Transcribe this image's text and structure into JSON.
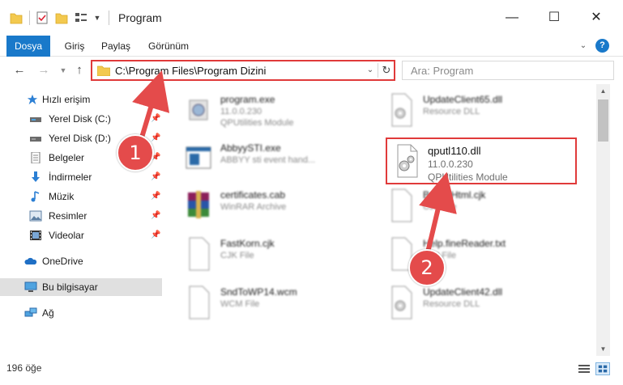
{
  "window": {
    "title": "Program",
    "minimize": "—",
    "maximize": "☐",
    "close": "✕"
  },
  "ribbon": {
    "tabs": [
      "Dosya",
      "Giriş",
      "Paylaş",
      "Görünüm"
    ],
    "active_tab": "Dosya",
    "help": "?"
  },
  "nav": {
    "back": "←",
    "forward": "→",
    "recent": "⌄",
    "up": "↑",
    "address": "C:\\Program Files\\Program Dizini",
    "refresh": "↻",
    "search_placeholder": "Ara: Program"
  },
  "sidebar": {
    "items": [
      {
        "label": "Hızlı erişim",
        "icon": "star-icon"
      },
      {
        "label": "Yerel Disk (C:)",
        "icon": "drive-icon",
        "pinned": true
      },
      {
        "label": "Yerel Disk (D:)",
        "icon": "drive-icon",
        "pinned": true
      },
      {
        "label": "Belgeler",
        "icon": "documents-icon",
        "pinned": true
      },
      {
        "label": "İndirmeler",
        "icon": "download-icon",
        "pinned": true
      },
      {
        "label": "Müzik",
        "icon": "music-icon",
        "pinned": true
      },
      {
        "label": "Resimler",
        "icon": "pictures-icon",
        "pinned": true
      },
      {
        "label": "Videolar",
        "icon": "video-icon",
        "pinned": true
      },
      {
        "label": "OneDrive",
        "icon": "cloud-icon"
      },
      {
        "label": "Bu bilgisayar",
        "icon": "computer-icon",
        "selected": true
      },
      {
        "label": "Ağ",
        "icon": "network-icon"
      }
    ]
  },
  "files": [
    {
      "name": "program.exe",
      "line1": "11.0.0.230",
      "line2": "QPUtilities Module",
      "icon": "exe-icon"
    },
    {
      "name": "UpdateClient65.dll",
      "line1": "Resource DLL",
      "line2": "",
      "icon": "dll-gear-icon"
    },
    {
      "name": "AbbyySTI.exe",
      "line1": "ABBYY sti event hand...",
      "line2": "",
      "icon": "exe-window-icon"
    },
    {
      "name": "certificates.cab",
      "line1": "WinRAR Archive",
      "line2": "",
      "icon": "winrar-icon"
    },
    {
      "name": "ButtonHtml.cjk",
      "line1": "CJK File",
      "line2": "",
      "icon": "blank-file-icon"
    },
    {
      "name": "FastKorn.cjk",
      "line1": "CJK File",
      "line2": "",
      "icon": "blank-file-icon"
    },
    {
      "name": "Help.fineReader.txt",
      "line1": "Text File",
      "line2": "",
      "icon": "blank-file-icon"
    },
    {
      "name": "SndToWP14.wcm",
      "line1": "WCM File",
      "line2": "",
      "icon": "blank-file-icon"
    },
    {
      "name": "UpdateClient42.dll",
      "line1": "Resource DLL",
      "line2": "",
      "icon": "dll-gear-icon"
    }
  ],
  "highlighted_file": {
    "name": "qputl110.dll",
    "line1": "11.0.0.230",
    "line2": "QPUtilities Module"
  },
  "annotations": {
    "step1": "1",
    "step2": "2",
    "color": "#e44b4b"
  },
  "status": {
    "item_count": "196 öğe"
  },
  "colors": {
    "accent": "#1979ca",
    "highlight_border": "#e03a3a"
  }
}
